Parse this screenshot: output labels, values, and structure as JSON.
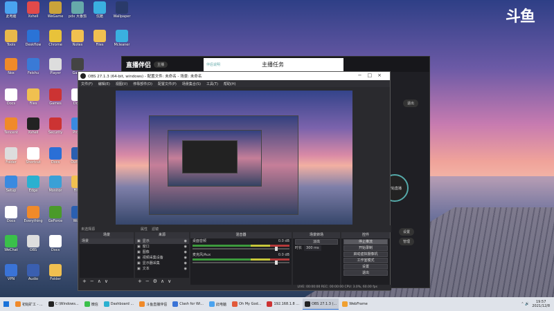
{
  "desktop": {
    "brand_logo": "斗鱼",
    "icons": [
      {
        "label": "此电脑",
        "color": "#4aa3f0"
      },
      {
        "label": "Xshell",
        "color": "#e24a4a"
      },
      {
        "label": "WeGame",
        "color": "#caa33a"
      },
      {
        "label": "pdx 大番茄",
        "color": "#6aa"
      },
      {
        "label": "优酷",
        "color": "#3ab0e0"
      },
      {
        "label": "Wallpaper",
        "color": "#2a3a6a"
      },
      {
        "label": "Tools",
        "color": "#e8b84a"
      },
      {
        "label": "Deskflow",
        "color": "#2a73d6"
      },
      {
        "label": "Chrome",
        "color": "#e8c23a"
      },
      {
        "label": "Notes",
        "color": "#f0c050"
      },
      {
        "label": "Files",
        "color": "#f0c050"
      },
      {
        "label": "Mcleaner",
        "color": "#3ab0e0"
      },
      {
        "label": "Nox",
        "color": "#f08a2a"
      },
      {
        "label": "Feishu",
        "color": "#3a7ad6"
      },
      {
        "label": "Player",
        "color": "#ddd"
      },
      {
        "label": "Game",
        "color": "#444"
      },
      {
        "label": "Docs",
        "color": "#fff"
      },
      {
        "label": "Files",
        "color": "#f0c050"
      },
      {
        "label": "Games",
        "color": "#c33"
      },
      {
        "label": "Docs",
        "color": "#fff"
      },
      {
        "label": "Tencent",
        "color": "#f08a2a"
      },
      {
        "label": "Xshell",
        "color": "#222"
      },
      {
        "label": "Security",
        "color": "#c33"
      },
      {
        "label": "Proxy",
        "color": "#3a8ae0"
      },
      {
        "label": "Folder",
        "color": "#ddd"
      },
      {
        "label": "Shortcut",
        "color": "#fff"
      },
      {
        "label": "Docs",
        "color": "#2a6fd6"
      },
      {
        "label": "Outlook",
        "color": "#2a5fb0"
      },
      {
        "label": "Setup",
        "color": "#3a8ae0"
      },
      {
        "label": "Edge",
        "color": "#2ab0d0"
      },
      {
        "label": "Monitor",
        "color": "#3aa0d6"
      },
      {
        "label": "Files",
        "color": "#f0c050"
      },
      {
        "label": "Docs",
        "color": "#fff"
      },
      {
        "label": "Everything",
        "color": "#f08a2a"
      },
      {
        "label": "GeForce",
        "color": "#4a9a2a"
      },
      {
        "label": "Word",
        "color": "#2a5fb0"
      },
      {
        "label": "WeChat",
        "color": "#3ac04a"
      },
      {
        "label": "OBS",
        "color": "#ddd"
      },
      {
        "label": "Docs",
        "color": "#fff"
      },
      {
        "label": "VPN",
        "color": "#3a73d6"
      },
      {
        "label": "Audio",
        "color": "#3a5fb0"
      },
      {
        "label": "Folder",
        "color": "#f0c050"
      }
    ]
  },
  "zhibo": {
    "logo": "直播伴侣",
    "badge": "主播",
    "tab_small": "伴侣说明",
    "tab_title": "主播任务",
    "btn_exit": "退出",
    "circle_text": "开始直播",
    "pill_1": "设置",
    "pill_2": "管理"
  },
  "obs": {
    "title": "OBS 27.1.3 (64-bit, windows) - 配置文件: 未命名 - 场景: 未命名",
    "menu": [
      "文件(F)",
      "编辑(E)",
      "视图(V)",
      "停靠部件(D)",
      "配置文件(P)",
      "场景集合(S)",
      "工具(T)",
      "帮助(H)"
    ],
    "status_left": "未选择源",
    "status_props": "属性",
    "status_filter": "滤镜",
    "docks": {
      "scenes": {
        "header": "场景",
        "items": [
          "场景"
        ]
      },
      "sources": {
        "header": "来源",
        "items": [
          "显示",
          "窗口",
          "图像",
          "视频采集设备",
          "显示器采集",
          "文本"
        ]
      },
      "mixer": {
        "header": "混音器",
        "tracks": [
          {
            "name": "桌面音频",
            "db": "0.0 dB"
          },
          {
            "name": "麦克风/Aux",
            "db": "0.0 dB"
          }
        ]
      },
      "transitions": {
        "header": "场景转场",
        "type": "淡出",
        "duration_label": "时长",
        "duration": "300 ms"
      },
      "controls": {
        "header": "控件",
        "buttons": [
          "停止推流",
          "开始录制",
          "启动虚拟摄像机",
          "工作室模式",
          "设置",
          "退出"
        ]
      }
    },
    "statusbar": "LIVE: 00:00:00   REC: 00:00:00   CPU: 3.0%, 60.00 fps"
  },
  "taskbar": {
    "items": [
      {
        "label": "初始矿工 - ...",
        "color": "#f08a2a"
      },
      {
        "label": "C:\\Windows...",
        "color": "#222"
      },
      {
        "label": "微信",
        "color": "#3ac04a"
      },
      {
        "label": "Dashboard ...",
        "color": "#2ab0d0"
      },
      {
        "label": "斗鱼直播伴侣",
        "color": "#f08a2a"
      },
      {
        "label": "Clash for Wi...",
        "color": "#3a73d6"
      },
      {
        "label": "此电脑",
        "color": "#4aa3f0"
      },
      {
        "label": "Oh My God...",
        "color": "#e25a3a"
      },
      {
        "label": "192.168.1.8 ...",
        "color": "#c33"
      },
      {
        "label": "OBS 27.1.3 (...",
        "color": "#222"
      },
      {
        "label": "WebFrame",
        "color": "#f0a030"
      }
    ],
    "time": "19:57",
    "date": "2021/12/8"
  }
}
